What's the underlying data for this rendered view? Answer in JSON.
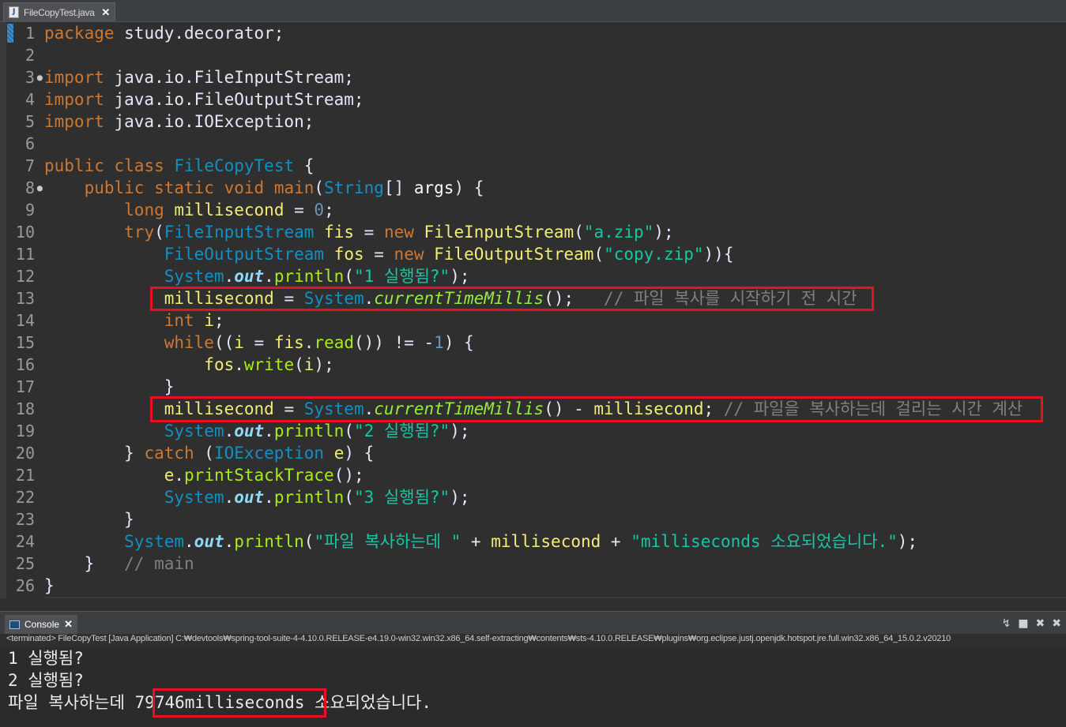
{
  "editor_tab": {
    "title": "FileCopyTest.java",
    "close": "✕",
    "icon": "java-file-icon"
  },
  "code_lines": [
    {
      "n": "1",
      "tokens": [
        [
          "kw",
          "package"
        ],
        [
          "pl",
          " study.decorator;"
        ]
      ]
    },
    {
      "n": "2",
      "tokens": []
    },
    {
      "n": "3",
      "fold": true,
      "tokens": [
        [
          "kw",
          "import"
        ],
        [
          "pl",
          " java.io.FileInputStream;"
        ]
      ]
    },
    {
      "n": "4",
      "tokens": [
        [
          "kw",
          "import"
        ],
        [
          "pl",
          " java.io.FileOutputStream;"
        ]
      ]
    },
    {
      "n": "5",
      "tokens": [
        [
          "kw",
          "import"
        ],
        [
          "pl",
          " java.io.IOException;"
        ]
      ]
    },
    {
      "n": "6",
      "tokens": []
    },
    {
      "n": "7",
      "tokens": [
        [
          "kw",
          "public"
        ],
        [
          "pl",
          " "
        ],
        [
          "kw",
          "class"
        ],
        [
          "pl",
          " "
        ],
        [
          "ty",
          "FileCopyTest"
        ],
        [
          "pl",
          " {"
        ]
      ]
    },
    {
      "n": "8",
      "fold": true,
      "tokens": [
        [
          "pl",
          "    "
        ],
        [
          "kw",
          "public"
        ],
        [
          "pl",
          " "
        ],
        [
          "kw",
          "static"
        ],
        [
          "pl",
          " "
        ],
        [
          "kw",
          "void"
        ],
        [
          "pl",
          " "
        ],
        [
          "kw2",
          "main"
        ],
        [
          "pl",
          "("
        ],
        [
          "ty",
          "String"
        ],
        [
          "pl",
          "[] "
        ],
        [
          "id",
          "args"
        ],
        [
          "pl",
          ") {"
        ]
      ]
    },
    {
      "n": "9",
      "tokens": [
        [
          "pl",
          "        "
        ],
        [
          "kw",
          "long"
        ],
        [
          "pl",
          " "
        ],
        [
          "var",
          "millisecond"
        ],
        [
          "pl",
          " = "
        ],
        [
          "num",
          "0"
        ],
        [
          "pl",
          ";"
        ]
      ]
    },
    {
      "n": "10",
      "tokens": [
        [
          "pl",
          "        "
        ],
        [
          "kw",
          "try"
        ],
        [
          "pl",
          "("
        ],
        [
          "ty",
          "FileInputStream"
        ],
        [
          "pl",
          " "
        ],
        [
          "var",
          "fis"
        ],
        [
          "pl",
          " = "
        ],
        [
          "kw",
          "new"
        ],
        [
          "pl",
          " "
        ],
        [
          "var",
          "FileInputStream"
        ],
        [
          "pl",
          "("
        ],
        [
          "str",
          "\"a.zip\""
        ],
        [
          "pl",
          ");"
        ]
      ]
    },
    {
      "n": "11",
      "tokens": [
        [
          "pl",
          "            "
        ],
        [
          "ty",
          "FileOutputStream"
        ],
        [
          "pl",
          " "
        ],
        [
          "var",
          "fos"
        ],
        [
          "pl",
          " = "
        ],
        [
          "kw",
          "new"
        ],
        [
          "pl",
          " "
        ],
        [
          "var",
          "FileOutputStream"
        ],
        [
          "pl",
          "("
        ],
        [
          "str",
          "\"copy.zip\""
        ],
        [
          "pl",
          ")){"
        ]
      ]
    },
    {
      "n": "12",
      "tokens": [
        [
          "pl",
          "            "
        ],
        [
          "ty",
          "System"
        ],
        [
          "pl",
          "."
        ],
        [
          "fld",
          "out"
        ],
        [
          "pl",
          "."
        ],
        [
          "mth",
          "println"
        ],
        [
          "pl",
          "("
        ],
        [
          "str",
          "\"1 실행됨?\""
        ],
        [
          "pl",
          ");"
        ]
      ]
    },
    {
      "n": "13",
      "tokens": [
        [
          "pl",
          "            "
        ],
        [
          "var",
          "millisecond"
        ],
        [
          "pl",
          " = "
        ],
        [
          "ty",
          "System"
        ],
        [
          "pl",
          "."
        ],
        [
          "sm",
          "currentTimeMillis"
        ],
        [
          "pl",
          "();   "
        ],
        [
          "cm",
          "// 파일 복사를 시작하기 전 시간"
        ]
      ]
    },
    {
      "n": "14",
      "tokens": [
        [
          "pl",
          "            "
        ],
        [
          "kw",
          "int"
        ],
        [
          "pl",
          " "
        ],
        [
          "var",
          "i"
        ],
        [
          "pl",
          ";"
        ]
      ]
    },
    {
      "n": "15",
      "tokens": [
        [
          "pl",
          "            "
        ],
        [
          "kw",
          "while"
        ],
        [
          "pl",
          "(("
        ],
        [
          "var",
          "i"
        ],
        [
          "pl",
          " = "
        ],
        [
          "var",
          "fis"
        ],
        [
          "pl",
          "."
        ],
        [
          "mth",
          "read"
        ],
        [
          "pl",
          "()) != -"
        ],
        [
          "num",
          "1"
        ],
        [
          "pl",
          ") {"
        ]
      ]
    },
    {
      "n": "16",
      "tokens": [
        [
          "pl",
          "                "
        ],
        [
          "var",
          "fos"
        ],
        [
          "pl",
          "."
        ],
        [
          "mth",
          "write"
        ],
        [
          "pl",
          "("
        ],
        [
          "var",
          "i"
        ],
        [
          "pl",
          ");"
        ]
      ]
    },
    {
      "n": "17",
      "tokens": [
        [
          "pl",
          "            }"
        ]
      ]
    },
    {
      "n": "18",
      "tokens": [
        [
          "pl",
          "            "
        ],
        [
          "var",
          "millisecond"
        ],
        [
          "pl",
          " = "
        ],
        [
          "ty",
          "System"
        ],
        [
          "pl",
          "."
        ],
        [
          "sm",
          "currentTimeMillis"
        ],
        [
          "pl",
          "() - "
        ],
        [
          "var",
          "millisecond"
        ],
        [
          "pl",
          "; "
        ],
        [
          "cm",
          "// 파일을 복사하는데 걸리는 시간 계산"
        ]
      ]
    },
    {
      "n": "19",
      "tokens": [
        [
          "pl",
          "            "
        ],
        [
          "ty",
          "System"
        ],
        [
          "pl",
          "."
        ],
        [
          "fld",
          "out"
        ],
        [
          "pl",
          "."
        ],
        [
          "mth",
          "println"
        ],
        [
          "pl",
          "("
        ],
        [
          "str",
          "\"2 실행됨?\""
        ],
        [
          "pl",
          ");"
        ]
      ]
    },
    {
      "n": "20",
      "tokens": [
        [
          "pl",
          "        } "
        ],
        [
          "kw",
          "catch"
        ],
        [
          "pl",
          " ("
        ],
        [
          "ty",
          "IOException"
        ],
        [
          "pl",
          " "
        ],
        [
          "var",
          "e"
        ],
        [
          "pl",
          ") {"
        ]
      ]
    },
    {
      "n": "21",
      "tokens": [
        [
          "pl",
          "            "
        ],
        [
          "var",
          "e"
        ],
        [
          "pl",
          "."
        ],
        [
          "mth",
          "printStackTrace"
        ],
        [
          "pl",
          "();"
        ]
      ]
    },
    {
      "n": "22",
      "tokens": [
        [
          "pl",
          "            "
        ],
        [
          "ty",
          "System"
        ],
        [
          "pl",
          "."
        ],
        [
          "fld",
          "out"
        ],
        [
          "pl",
          "."
        ],
        [
          "mth",
          "println"
        ],
        [
          "pl",
          "("
        ],
        [
          "str",
          "\"3 실행됨?\""
        ],
        [
          "pl",
          ");"
        ]
      ]
    },
    {
      "n": "23",
      "tokens": [
        [
          "pl",
          "        }"
        ]
      ]
    },
    {
      "n": "24",
      "tokens": [
        [
          "pl",
          "        "
        ],
        [
          "ty",
          "System"
        ],
        [
          "pl",
          "."
        ],
        [
          "fld",
          "out"
        ],
        [
          "pl",
          "."
        ],
        [
          "mth",
          "println"
        ],
        [
          "pl",
          "("
        ],
        [
          "str",
          "\"파일 복사하는데 \""
        ],
        [
          "pl",
          " + "
        ],
        [
          "var",
          "millisecond"
        ],
        [
          "pl",
          " + "
        ],
        [
          "str",
          "\"milliseconds 소요되었습니다.\""
        ],
        [
          "pl",
          ");"
        ]
      ]
    },
    {
      "n": "25",
      "tokens": [
        [
          "pl",
          "    }   "
        ],
        [
          "cm",
          "// main"
        ]
      ]
    },
    {
      "n": "26",
      "tokens": [
        [
          "pl",
          "}"
        ]
      ]
    }
  ],
  "scroll_marker": "<",
  "console": {
    "tab_label": "Console",
    "close": "✕",
    "tools": [
      "↯",
      "■",
      "✖",
      "✖"
    ],
    "status": "<terminated> FileCopyTest [Java Application] C:₩devtools₩spring-tool-suite-4-4.10.0.RELEASE-e4.19.0-win32.win32.x86_64.self-extracting₩contents₩sts-4.10.0.RELEASE₩plugins₩org.eclipse.justj.openjdk.hotspot.jre.full.win32.x86_64_15.0.2.v20210",
    "output": [
      "1 실행됨?",
      "2 실행됨?"
    ],
    "last_line": {
      "prefix": "파일 복사하는데 ",
      "highlight": "79746milliseconds",
      "suffix": " 소요되었습니다."
    }
  },
  "colors": {
    "highlight_box": "#e81123",
    "background": "#2f2f2f"
  }
}
